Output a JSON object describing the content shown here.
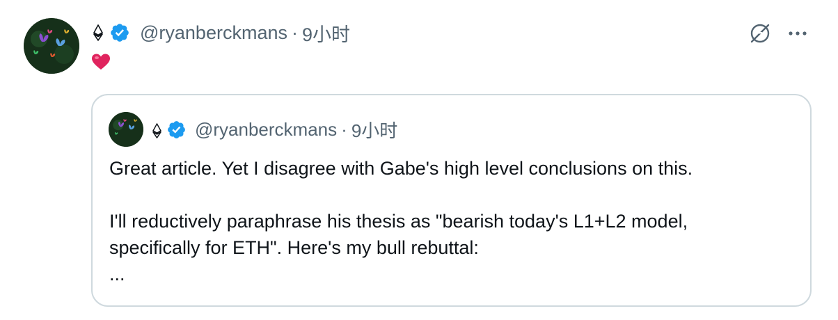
{
  "tweet": {
    "author_name_symbol": "⟠",
    "handle": "@ryanberckmans",
    "separator": "·",
    "time": "9小时",
    "reaction": "❤️"
  },
  "quote": {
    "author_name_symbol": "⟠",
    "handle": "@ryanberckmans",
    "separator": "·",
    "time": "9小时",
    "lines": [
      "Great article. Yet I disagree with Gabe's high level conclusions on this.",
      "I'll reductively paraphrase his thesis as \"bearish today's L1+L2 model,",
      "specifically for ETH\". Here's my bull rebuttal:",
      "..."
    ]
  },
  "icons": {
    "verified": "verified-badge-icon",
    "eth": "ethereum-icon",
    "grok": "grok-icon",
    "more": "more-options-icon",
    "heart": "heart-icon"
  },
  "colors": {
    "verified_blue": "#1d9bf0",
    "secondary_text": "#536471",
    "border": "#cfd9de",
    "heart_red": "#e0245e"
  }
}
